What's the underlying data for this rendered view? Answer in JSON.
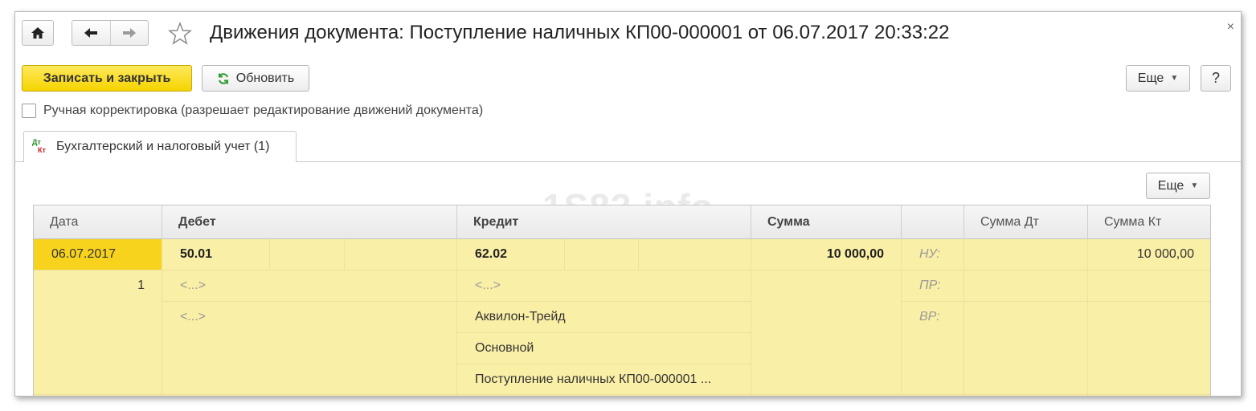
{
  "window": {
    "title": "Движения документа: Поступление наличных КП00-000001 от 06.07.2017 20:33:22",
    "close_glyph": "×"
  },
  "toolbar": {
    "save_close_label": "Записать и закрыть",
    "refresh_label": "Обновить",
    "more_label": "Еще",
    "help_label": "?"
  },
  "manual_correction": {
    "label": "Ручная корректировка (разрешает редактирование движений документа)",
    "checked": false
  },
  "tabs": [
    {
      "label": "Бухгалтерский и налоговый учет (1)",
      "icon": "dt-kt-icon",
      "active": true
    }
  ],
  "table_toolbar": {
    "more_label": "Еще"
  },
  "watermark": "1S83.info",
  "table": {
    "columns": [
      "Дата",
      "Дебет",
      "Кредит",
      "Сумма",
      "",
      "Сумма Дт",
      "Сумма Кт"
    ],
    "row": {
      "date": "06.07.2017",
      "line_no": "1",
      "debit_account": "50.01",
      "debit_subconto_1": "<...>",
      "debit_subconto_2": "<...>",
      "credit_account": "62.02",
      "credit_subconto_1": "<...>",
      "credit_subconto_2": "Аквилон-Трейд",
      "credit_subconto_3": "Основной",
      "credit_subconto_4": "Поступление наличных КП00-000001 ...",
      "amount": "10 000,00",
      "type_nu": "НУ:",
      "type_pr": "ПР:",
      "type_vr": "ВР:",
      "amount_kt": "10 000,00"
    }
  },
  "colors": {
    "primary_button": "#f5d400",
    "row_background": "#faefa6",
    "selected_cell": "#f7d31e",
    "header_background": "#efefef"
  }
}
